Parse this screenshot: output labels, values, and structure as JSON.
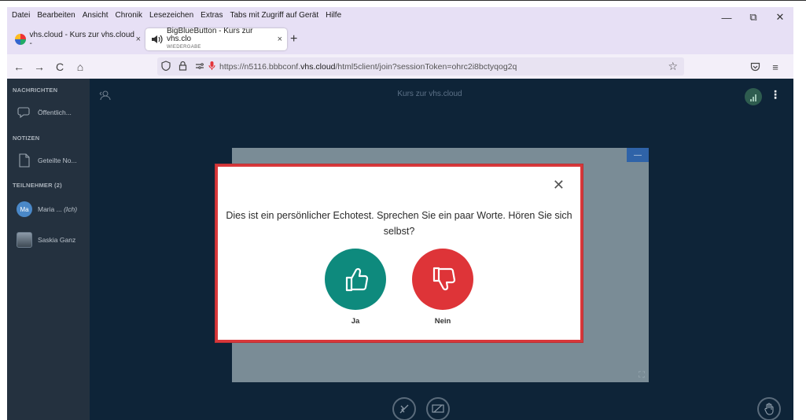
{
  "browser": {
    "menu": [
      "Datei",
      "Bearbeiten",
      "Ansicht",
      "Chronik",
      "Lesezeichen",
      "Extras",
      "Tabs mit Zugriff auf Gerät",
      "Hilfe"
    ],
    "window_controls": {
      "minimize": "—",
      "restore": "⧉",
      "close": "✕"
    },
    "tabs": [
      {
        "title": "vhs.cloud - Kurs zur vhs.cloud -",
        "close": "×"
      },
      {
        "title": "BigBlueButton - Kurs zur vhs.clo",
        "subtitle": "WIEDERGABE",
        "close": "×"
      }
    ],
    "new_tab": "+",
    "nav": {
      "back": "←",
      "forward": "→",
      "reload": "C",
      "home": "⌂"
    },
    "url": {
      "prefix": "https://n5116.bbbconf.",
      "domain": "vhs.cloud",
      "suffix": "/html5client/join?sessionToken=ohrc2i8bctyqog2q"
    }
  },
  "app": {
    "meeting_title": "Kurs zur vhs.cloud",
    "sidebar": {
      "messages_header": "NACHRICHTEN",
      "public_chat": "Öffentlich...",
      "notes_header": "NOTIZEN",
      "shared_notes": "Geteilte No...",
      "participants_header": "TEILNEHMER (2)",
      "participants": [
        {
          "initials": "Ma",
          "name": "Maria ...",
          "suffix": "(Ich)"
        },
        {
          "name": "Saskia Ganz"
        }
      ]
    },
    "presentation": {
      "minimize": "—",
      "fullscreen": "⛶"
    }
  },
  "modal": {
    "close": "✕",
    "text": "Dies ist ein persönlicher Echotest. Sprechen Sie ein paar Worte. Hören Sie sich selbst?",
    "yes_label": "Ja",
    "no_label": "Nein"
  },
  "colors": {
    "browser_chrome": "#e7e0f5",
    "app_background": "#0e2438",
    "sidebar": "#24313f",
    "yes_button": "#0e8a7d",
    "no_button": "#de3438",
    "modal_border": "#d9373a"
  }
}
